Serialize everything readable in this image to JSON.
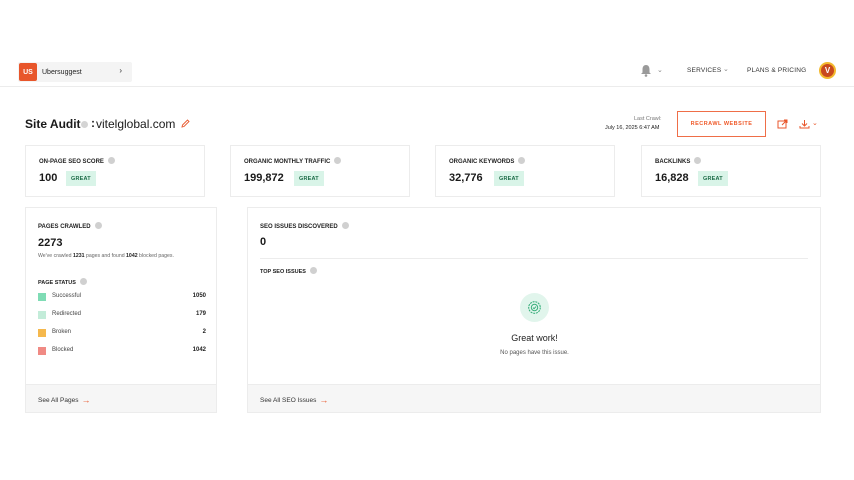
{
  "nav": {
    "brand_logo": "US",
    "brand_name": "Ubersuggest",
    "services": "SERVICES",
    "pricing": "PLANS & PRICING",
    "avatar_initial": "V"
  },
  "header": {
    "title": "Site Audit",
    "colon": ":",
    "domain": "vitelglobal.com",
    "last_crawl_label": "Last Crawl:",
    "last_crawl_date": "July 16, 2025 6:47 AM",
    "recrawl_label": "RECRAWL WEBSITE"
  },
  "metrics": [
    {
      "label": "ON-PAGE SEO SCORE",
      "value": "100",
      "badge": "GREAT"
    },
    {
      "label": "ORGANIC MONTHLY TRAFFIC",
      "value": "199,872",
      "badge": "GREAT"
    },
    {
      "label": "ORGANIC KEYWORDS",
      "value": "32,776",
      "badge": "GREAT"
    },
    {
      "label": "BACKLINKS",
      "value": "16,828",
      "badge": "GREAT"
    }
  ],
  "pages_crawled": {
    "label": "PAGES CRAWLED",
    "value": "2273",
    "note_prefix": "We've crawled",
    "note_pages": "1231",
    "note_middle": "pages and found",
    "note_blocked": "1042",
    "note_suffix": "blocked pages.",
    "status_label": "PAGE STATUS",
    "statuses": [
      {
        "name": "Successful",
        "count": "1050",
        "color": "#7fdcb5"
      },
      {
        "name": "Redirected",
        "count": "179",
        "color": "#c3ecd9"
      },
      {
        "name": "Broken",
        "count": "2",
        "color": "#f5b84d"
      },
      {
        "name": "Blocked",
        "count": "1042",
        "color": "#f08a84"
      }
    ],
    "footer_link": "See All Pages"
  },
  "seo_issues": {
    "label": "SEO ISSUES DISCOVERED",
    "value": "0",
    "top_label": "TOP SEO ISSUES",
    "great_title": "Great work!",
    "great_sub": "No pages have this issue.",
    "footer_link": "See All SEO Issues"
  },
  "colors": {
    "accent": "#e8562b",
    "badge_bg": "#d9f4e8",
    "badge_text": "#1c6b47"
  }
}
